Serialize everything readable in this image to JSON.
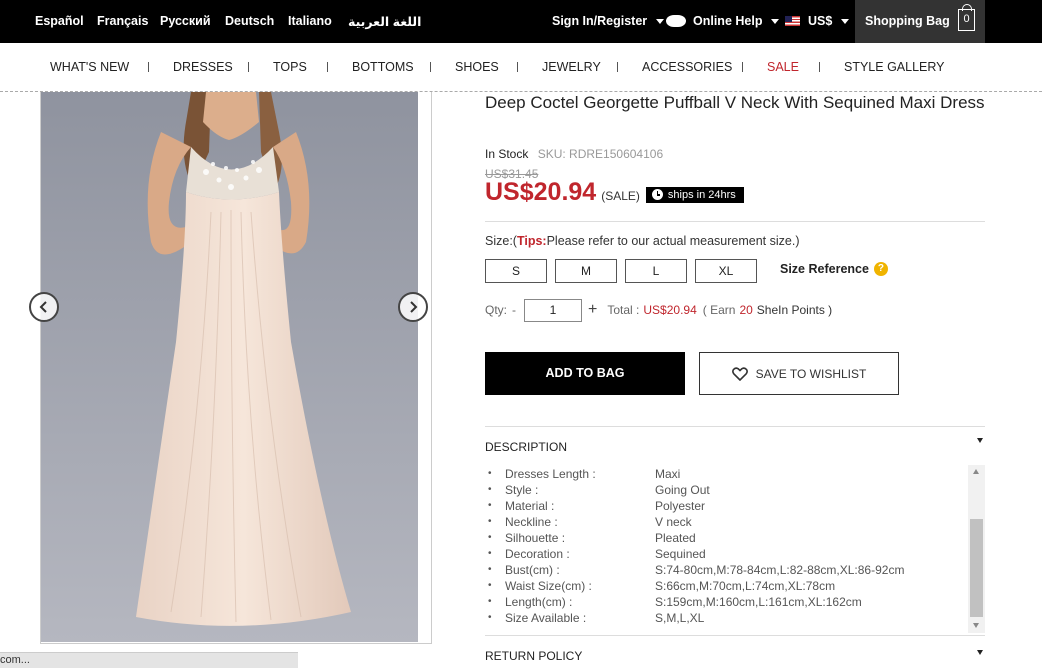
{
  "topbar": {
    "languages": [
      "Español",
      "Français",
      "Русский",
      "Deutsch",
      "Italiano",
      "اللغة العربية"
    ],
    "sign_in": "Sign In/Register",
    "online_help": "Online Help",
    "currency": "US$",
    "shopping_bag": "Shopping Bag",
    "bag_count": "0"
  },
  "nav": {
    "items": [
      "WHAT'S NEW",
      "DRESSES",
      "TOPS",
      "BOTTOMS",
      "SHOES",
      "JEWELRY",
      "ACCESSORIES",
      "SALE",
      "STYLE GALLERY"
    ]
  },
  "product": {
    "title": "Deep Coctel Georgette Puffball V Neck With Sequined Maxi Dress",
    "stock": "In Stock",
    "sku": "SKU: RDRE150604106",
    "old_price": "US$31.45",
    "price": "US$20.94",
    "sale_tag": "(SALE)",
    "ships": "ships in 24hrs"
  },
  "size": {
    "label": "Size:(",
    "tips": "Tips:",
    "tips_text": "Please refer to our actual measurement size.)",
    "options": [
      "S",
      "M",
      "L",
      "XL"
    ],
    "reference": "Size Reference"
  },
  "qty": {
    "label": "Qty:",
    "minus": "-",
    "value": "1",
    "plus": "+",
    "total_label": "Total :",
    "total_value": "US$20.94",
    "earn_pre": "( Earn",
    "earn_points": "20",
    "earn_post": "SheIn Points )"
  },
  "actions": {
    "add_to_bag": "ADD TO BAG",
    "save_wishlist": "SAVE TO WISHLIST"
  },
  "description": {
    "heading": "DESCRIPTION",
    "rows": [
      {
        "k": "Dresses Length :",
        "v": "Maxi"
      },
      {
        "k": "Style :",
        "v": "Going Out"
      },
      {
        "k": "Material :",
        "v": "Polyester"
      },
      {
        "k": "Neckline :",
        "v": "V neck"
      },
      {
        "k": "Silhouette :",
        "v": "Pleated"
      },
      {
        "k": "Decoration :",
        "v": "Sequined"
      },
      {
        "k": "Bust(cm) :",
        "v": "S:74-80cm,M:78-84cm,L:82-88cm,XL:86-92cm"
      },
      {
        "k": "Waist Size(cm) :",
        "v": "S:66cm,M:70cm,L:74cm,XL:78cm"
      },
      {
        "k": "Length(cm) :",
        "v": "S:159cm,M:160cm,L:161cm,XL:162cm"
      },
      {
        "k": "Size Available :",
        "v": "S,M,L,XL"
      }
    ]
  },
  "return_policy": "RETURN POLICY",
  "status_bar": "com..."
}
